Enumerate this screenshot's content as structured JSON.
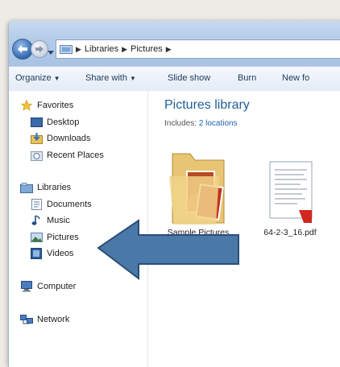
{
  "window": {
    "address": {
      "crumbs": [
        "Libraries",
        "Pictures"
      ]
    },
    "toolbar": {
      "organize": "Organize",
      "share_with": "Share with",
      "slide_show": "Slide show",
      "burn": "Burn",
      "new_folder": "New fo"
    },
    "sidebar": {
      "favorites": "Favorites",
      "desktop": "Desktop",
      "downloads": "Downloads",
      "recent_places": "Recent Places",
      "libraries": "Libraries",
      "documents": "Documents",
      "music": "Music",
      "pictures": "Pictures",
      "videos": "Videos",
      "computer": "Computer",
      "network": "Network"
    },
    "content": {
      "title": "Pictures library",
      "includes_label": "Includes:",
      "includes_link": "2 locations",
      "items": [
        {
          "name": "Sample Pictures",
          "icon": "folder-icon"
        },
        {
          "name": "64-2-3_16.pdf",
          "icon": "pdf-file-icon"
        }
      ]
    }
  },
  "annotation": {
    "icon": "arrow-left-icon",
    "color": "#4a79a8"
  }
}
